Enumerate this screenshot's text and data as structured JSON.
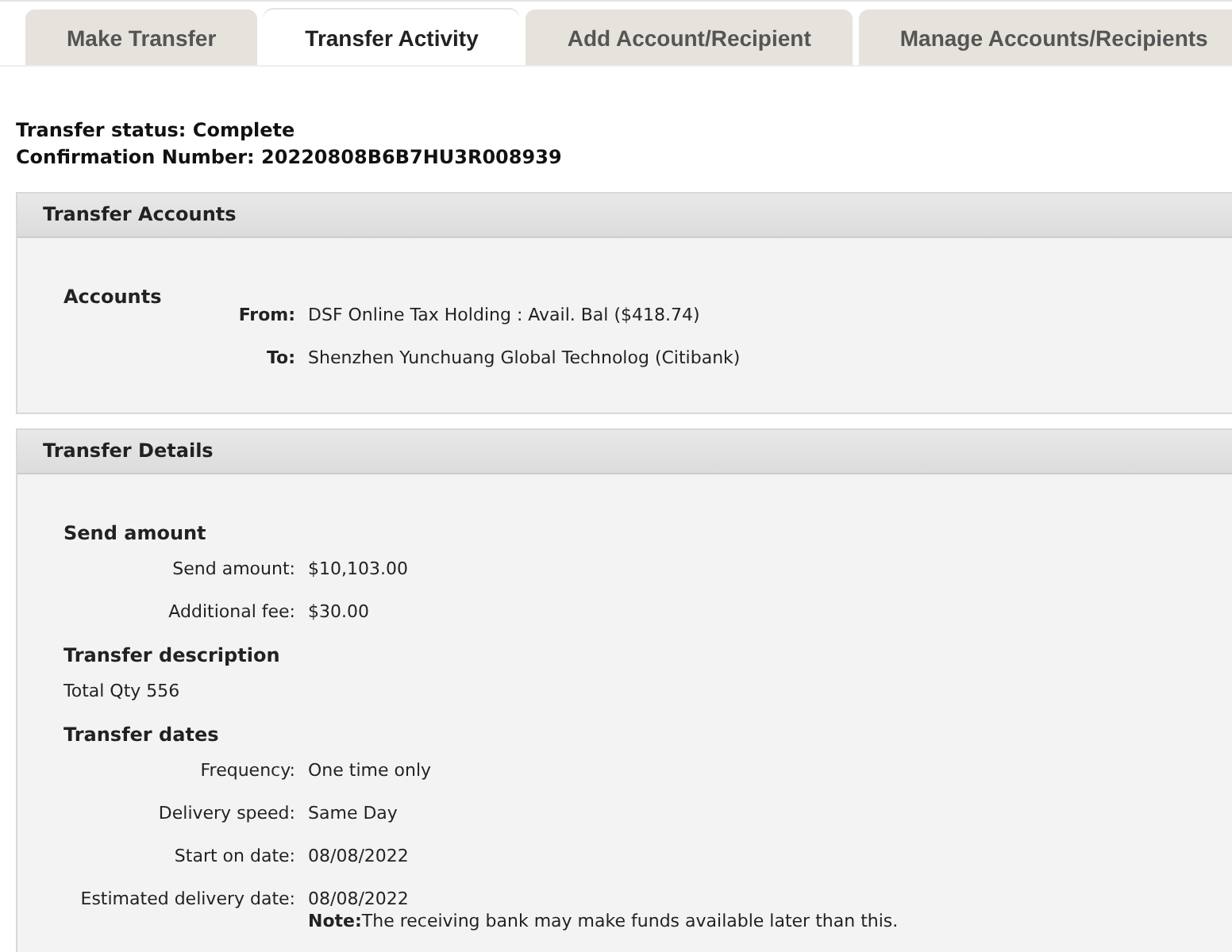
{
  "tabs": [
    {
      "label": "Make Transfer",
      "selected": false
    },
    {
      "label": "Transfer Activity",
      "selected": true
    },
    {
      "label": "Add Account/Recipient",
      "selected": false
    },
    {
      "label": "Manage Accounts/Recipients",
      "selected": false
    }
  ],
  "status_lines": [
    "Transfer status: Complete",
    "Confirmation Number: 20220808B6B7HU3R008939"
  ],
  "panels": [
    {
      "title": "Transfer Accounts",
      "items": [
        {
          "kind": "heading",
          "text": "Accounts"
        },
        {
          "kind": "account_field",
          "label": "From:",
          "value": "DSF Online Tax Holding : Avail. Bal ($418.74)"
        },
        {
          "kind": "account_field",
          "label": "To:",
          "value": "Shenzhen Yunchuang Global Technolog (Citibank)"
        }
      ]
    },
    {
      "title": "Transfer Details",
      "items": [
        {
          "kind": "heading",
          "text": "Send amount"
        },
        {
          "kind": "field",
          "label": "Send amount:",
          "value": "$10,103.00"
        },
        {
          "kind": "field",
          "label": "Additional fee:",
          "value": "$30.00"
        },
        {
          "kind": "heading",
          "text": "Transfer description"
        },
        {
          "kind": "text",
          "text": "Total Qty 556"
        },
        {
          "kind": "heading",
          "text": "Transfer dates"
        },
        {
          "kind": "field",
          "label": "Frequency:",
          "value": "One time only"
        },
        {
          "kind": "field",
          "label": "Delivery speed:",
          "value": "Same Day"
        },
        {
          "kind": "field",
          "label": "Start on date:",
          "value": "08/08/2022"
        },
        {
          "kind": "field",
          "label": "Estimated delivery date:",
          "value": "08/08/2022",
          "note": "**Note:**The receiving bank may make funds available later than this."
        }
      ]
    }
  ]
}
